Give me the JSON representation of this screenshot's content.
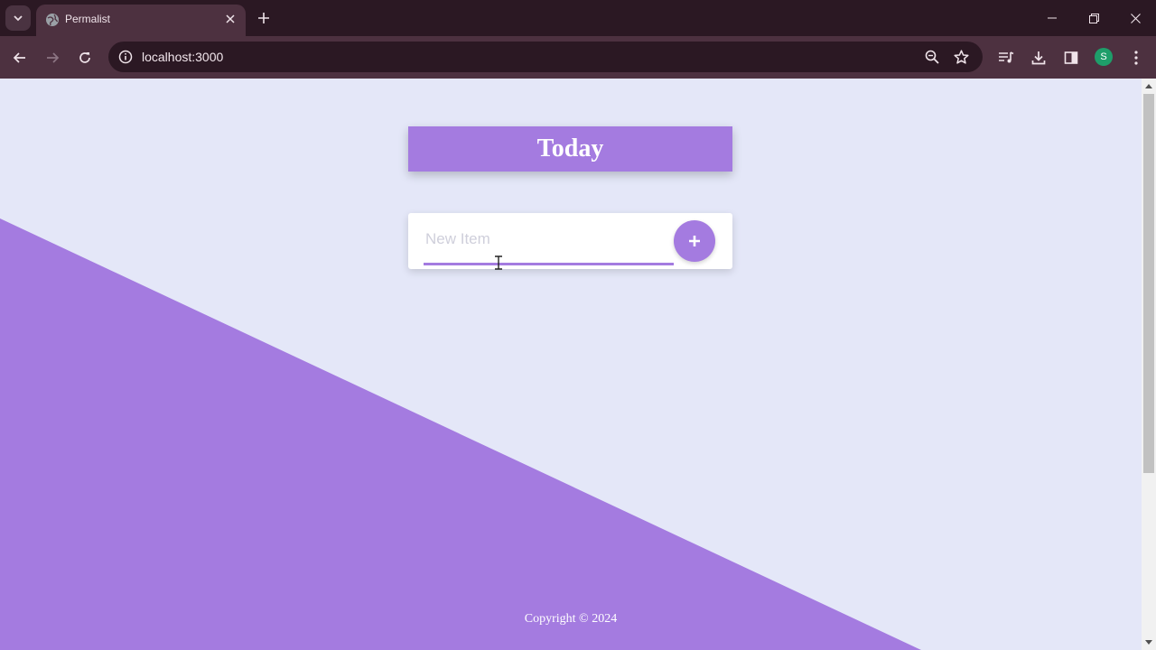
{
  "browser": {
    "tab": {
      "title": "Permalist",
      "favicon": "globe-icon"
    },
    "address_bar": {
      "url": "localhost:3000"
    },
    "profile_initial": "S",
    "colors": {
      "frame": "#2b1823",
      "toolbar": "#4d3140",
      "profile": "#1e9e6a"
    }
  },
  "page": {
    "heading": "Today",
    "new_item": {
      "placeholder": "New Item",
      "value": "",
      "add_button": "+"
    },
    "footer": "Copyright © 2024",
    "colors": {
      "accent": "#a47be0",
      "background": "#e4e7f8",
      "card": "#ffffff"
    }
  }
}
